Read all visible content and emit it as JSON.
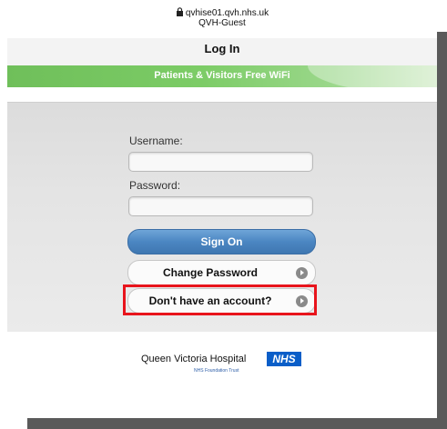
{
  "status": {
    "url": "qvhise01.qvh.nhs.uk",
    "ssid": "QVH-Guest"
  },
  "nav": {
    "title": "Log In"
  },
  "banner": {
    "text": "Patients & Visitors Free WiFi"
  },
  "form": {
    "username_label": "Username:",
    "username_value": "",
    "password_label": "Password:",
    "password_value": "",
    "signon_label": "Sign On",
    "change_password_label": "Change Password",
    "no_account_label": "Don't have an account?"
  },
  "footer": {
    "hospital_name": "Queen Victoria Hospital",
    "nhs_logo": "NHS",
    "trust_text": "NHS Foundation Trust"
  },
  "colors": {
    "banner_green": "#6fbf5a",
    "button_blue": "#4b86c2",
    "highlight_red": "#e8141c",
    "nhs_blue": "#0a5ec8"
  },
  "icons": [
    "lock-icon",
    "chevron-right-icon"
  ]
}
